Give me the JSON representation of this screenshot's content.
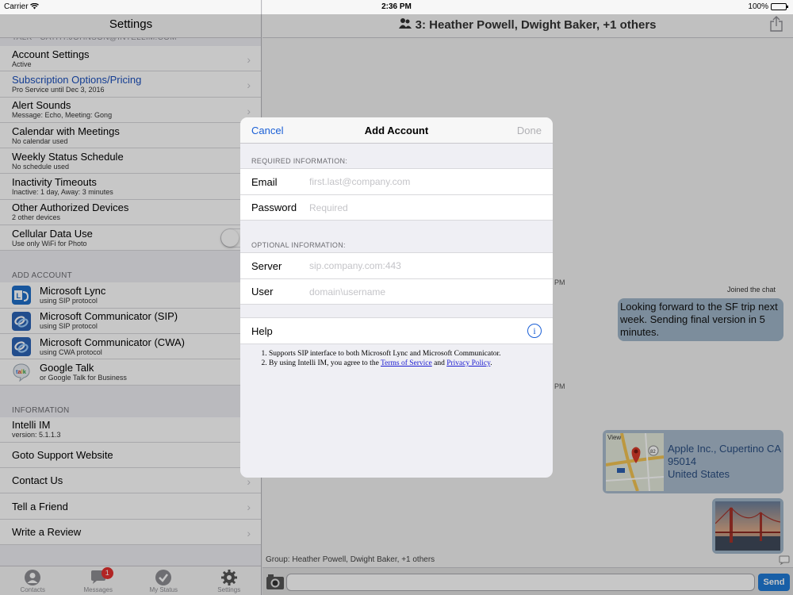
{
  "status_bar": {
    "carrier": "Carrier",
    "time": "2:36 PM",
    "battery": "100%"
  },
  "left": {
    "title": "Settings",
    "top_header": "TALK - CATHY.JOHNSON@INTELLIM.COM",
    "account_rows": [
      {
        "main": "Account Settings",
        "sub": "Active"
      },
      {
        "main": "Subscription Options/Pricing",
        "sub": "Pro Service until Dec 3, 2016"
      },
      {
        "main": "Alert Sounds",
        "sub": "Message: Echo, Meeting: Gong"
      },
      {
        "main": "Calendar with Meetings",
        "sub": "No calendar used"
      },
      {
        "main": "Weekly Status Schedule",
        "sub": "No schedule used"
      },
      {
        "main": "Inactivity Timeouts",
        "sub": "Inactive: 1 day, Away: 3 minutes"
      },
      {
        "main": "Other Authorized Devices",
        "sub": "2 other devices"
      },
      {
        "main": "Cellular Data Use",
        "sub": "Use only WiFi for Photo"
      }
    ],
    "add_account_header": "ADD ACCOUNT",
    "add_account_rows": [
      {
        "main": "Microsoft Lync",
        "sub": "using SIP protocol"
      },
      {
        "main": "Microsoft Communicator (SIP)",
        "sub": "using SIP protocol"
      },
      {
        "main": "Microsoft Communicator (CWA)",
        "sub": "using CWA protocol"
      },
      {
        "main": "Google Talk",
        "sub": "or Google Talk for Business"
      }
    ],
    "information_header": "INFORMATION",
    "info_rows": [
      {
        "main": "Intelli IM",
        "sub": "version: 5.1.1.3"
      },
      {
        "main": "Goto Support Website"
      },
      {
        "main": "Contact Us"
      },
      {
        "main": "Tell a Friend"
      },
      {
        "main": "Write a Review"
      }
    ],
    "tabs": [
      {
        "label": "Contacts"
      },
      {
        "label": "Messages",
        "badge": "1"
      },
      {
        "label": "My Status"
      },
      {
        "label": "Settings"
      }
    ]
  },
  "chat": {
    "title": "3: Heather Powell, Dwight Baker, +1 others",
    "stamp1": "PM",
    "stamp2": "PM",
    "joined": "Joined the chat",
    "bubble": "Looking forward to the SF trip next week. Sending final version in 5 minutes.",
    "location_lines": [
      "Apple Inc., Cupertino CA",
      "95014",
      "United States"
    ],
    "map_label": "View",
    "footer": "Group: Heather Powell, Dwight Baker, +1 others",
    "send_label": "Send"
  },
  "modal": {
    "cancel": "Cancel",
    "title": "Add Account",
    "done": "Done",
    "required_header": "REQUIRED INFORMATION:",
    "email_label": "Email",
    "email_placeholder": "first.last@company.com",
    "password_label": "Password",
    "password_placeholder": "Required",
    "optional_header": "OPTIONAL INFORMATION:",
    "server_label": "Server",
    "server_placeholder": "sip.company.com:443",
    "user_label": "User",
    "user_placeholder": "domain\\username",
    "help_label": "Help",
    "note1": "Supports SIP interface to both Microsoft Lync and Microsoft Communicator.",
    "note2_prefix": "By using Intelli IM, you agree to the ",
    "note2_tos": "Terms of Service",
    "note2_and": " and ",
    "note2_privacy": "Privacy Policy",
    "note2_suffix": "."
  },
  "colors": {
    "link_blue": "#1a5fd6",
    "send_blue": "#1f7ad6",
    "badge_red": "#e3302f",
    "bubble": "#9fb5c8"
  }
}
